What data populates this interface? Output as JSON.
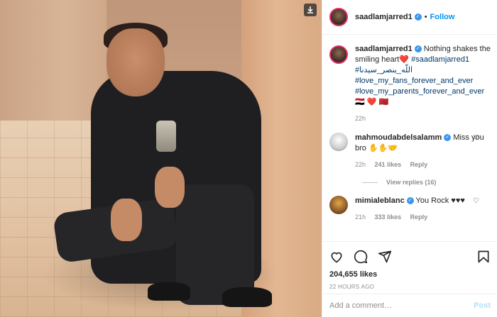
{
  "post": {
    "author": "saadlamjarred1",
    "follow_label": "Follow",
    "separator": "•",
    "verified_glyph": "✓"
  },
  "caption": {
    "username": "saadlamjarred1",
    "text": " Nothing shakes the smiling heart❤️ ",
    "tags": [
      "#saadlamjarred1",
      "#اللّه_ينصر_سيدنا",
      "#love_my_fans_forever_and_ever",
      "#love_my_parents_forever_and_ever"
    ],
    "suffix": "🇪🇬 ❤️ 🇲🇦",
    "age": "22h"
  },
  "comments": [
    {
      "username": "mahmoudabdelsalamm",
      "text": " Miss you bro ✋✋🤝",
      "age": "22h",
      "likes": "241 likes",
      "reply_label": "Reply",
      "view_replies": "View replies (16)"
    },
    {
      "username": "mimialeblanc",
      "text": " You Rock ♥♥♥",
      "age": "21h",
      "likes": "333 likes",
      "reply_label": "Reply"
    }
  ],
  "stats": {
    "likes": "204,655 likes",
    "time": "22 HOURS AGO"
  },
  "composer": {
    "placeholder": "Add a comment…",
    "post_label": "Post"
  },
  "icons": {
    "like": "heart-icon",
    "comment": "comment-icon",
    "share": "share-icon",
    "save": "bookmark-icon",
    "download": "download-icon"
  },
  "colors": {
    "accent": "#0095f6",
    "verified": "#3897f0",
    "link": "#00376b",
    "muted": "#8e8e8e",
    "post_disabled": "#b2dffc"
  }
}
